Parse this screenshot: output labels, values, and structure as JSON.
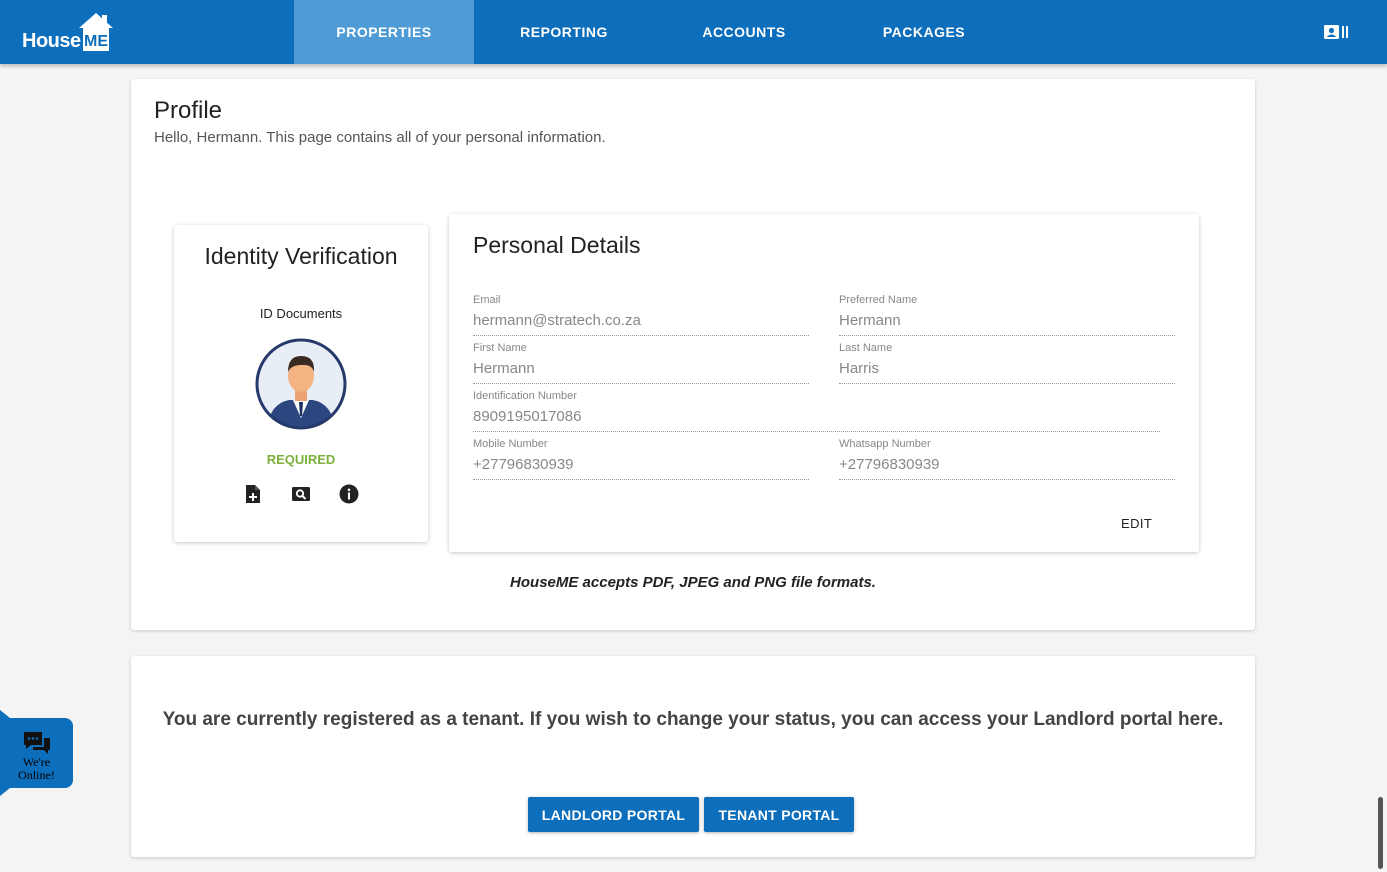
{
  "brand": {
    "logo_text": "House",
    "logo_suffix": "ME"
  },
  "nav": {
    "items": [
      {
        "label": "PROPERTIES",
        "active": true
      },
      {
        "label": "REPORTING",
        "active": false
      },
      {
        "label": "ACCOUNTS",
        "active": false
      },
      {
        "label": "PACKAGES",
        "active": false
      }
    ],
    "profile_icon": "contact-card-icon"
  },
  "profile": {
    "title": "Profile",
    "subtitle": "Hello, Hermann. This page contains all of your personal information."
  },
  "identity": {
    "title": "Identity Verification",
    "documents_label": "ID Documents",
    "status": "REQUIRED",
    "status_color": "#7bb03a",
    "actions": [
      "add-document-icon",
      "search-document-icon",
      "info-icon"
    ]
  },
  "personal_details": {
    "title": "Personal Details",
    "fields": {
      "email": {
        "label": "Email",
        "value": "hermann@stratech.co.za"
      },
      "preferred_name": {
        "label": "Preferred Name",
        "value": "Hermann"
      },
      "first_name": {
        "label": "First Name",
        "value": "Hermann"
      },
      "last_name": {
        "label": "Last Name",
        "value": "Harris"
      },
      "id_number": {
        "label": "Identification Number",
        "value": "8909195017086"
      },
      "mobile": {
        "label": "Mobile Number",
        "value": "+27796830939"
      },
      "whatsapp": {
        "label": "Whatsapp Number",
        "value": "+27796830939"
      }
    },
    "edit_label": "EDIT"
  },
  "formats_note": "HouseME accepts PDF, JPEG and PNG file formats.",
  "tenant": {
    "message": "You are currently registered as a tenant. If you wish to change your status, you can access your Landlord portal here.",
    "landlord_button": "LANDLORD PORTAL",
    "tenant_button": "TENANT PORTAL"
  },
  "chat": {
    "line1": "We're",
    "line2": "Online!",
    "icon": "chat-bubbles-icon"
  },
  "colors": {
    "primary": "#0d6ebb",
    "nav_active": "#4f9bd6"
  }
}
